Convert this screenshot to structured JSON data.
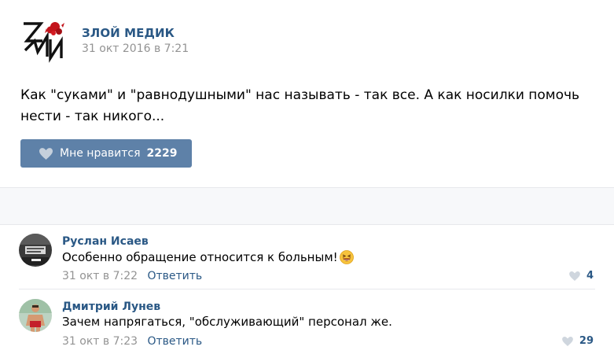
{
  "post": {
    "author": "ЗЛОЙ МЕДИК",
    "logo_text": "ЗМ",
    "date": "31 окт 2016 в 7:21",
    "text": "Как \"суками\" и \"равнодушными\" нас называть - так все. А как носилки помочь нести - так никого...",
    "like_label": "Мне нравится",
    "like_count": "2229"
  },
  "comments": [
    {
      "author": "Руслан Исаев",
      "text": "Особенно обращение относится к больным!",
      "emoji": "laughing-emoji",
      "date": "31 окт в 7:22",
      "reply_label": "Ответить",
      "likes": "4"
    },
    {
      "author": "Дмитрий Лунев",
      "text": "Зачем напрягаться, \"обслуживающий\" персонал же.",
      "date": "31 окт в 7:23",
      "reply_label": "Ответить",
      "likes": "29"
    }
  ],
  "colors": {
    "link": "#2a5885",
    "button": "#5e81a8",
    "meta": "#939393",
    "logo_red": "#c3141b"
  }
}
